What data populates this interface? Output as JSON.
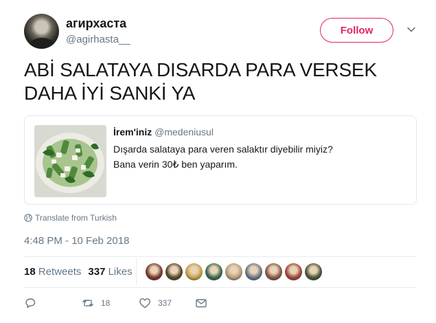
{
  "user": {
    "display_name": "агирхаста",
    "handle": "@agirhasta__"
  },
  "follow_button": {
    "label": "Follow",
    "color": "#e0245e"
  },
  "tweet": {
    "lines": [
      "ABİ SALATAYA DISARDA PARA VERSEK",
      "DAHA İYİ SANKİ YA"
    ]
  },
  "quoted_tweet": {
    "name": "İrem'iniz",
    "handle": "@medeniusul",
    "lines": [
      "Dışarda salataya para veren salaktır diyebilir miyiz?",
      "Bana verin 30₺ ben yaparım."
    ],
    "image": "salad-photo"
  },
  "translate_label": "Translate from Turkish",
  "timestamp": "4:48 PM - 10 Feb 2018",
  "stats": {
    "retweets_count": "18",
    "retweets_label": "Retweets",
    "likes_count": "337",
    "likes_label": "Likes"
  },
  "likers": [
    "#7a3b2e",
    "#5a4a2c",
    "#c9a24a",
    "#3c6d52",
    "#b7a07a",
    "#6c7a8a",
    "#8c5a4a",
    "#a24a3a",
    "#4a5a3a"
  ],
  "actions": {
    "reply": {
      "icon": "reply-icon",
      "count": ""
    },
    "retweet": {
      "icon": "retweet-icon",
      "count": "18"
    },
    "like": {
      "icon": "heart-icon",
      "count": "337"
    },
    "message": {
      "icon": "envelope-icon",
      "count": ""
    }
  },
  "colors": {
    "accent": "#e0245e",
    "muted": "#657786",
    "text": "#14171a",
    "border": "#e1e8ed"
  }
}
